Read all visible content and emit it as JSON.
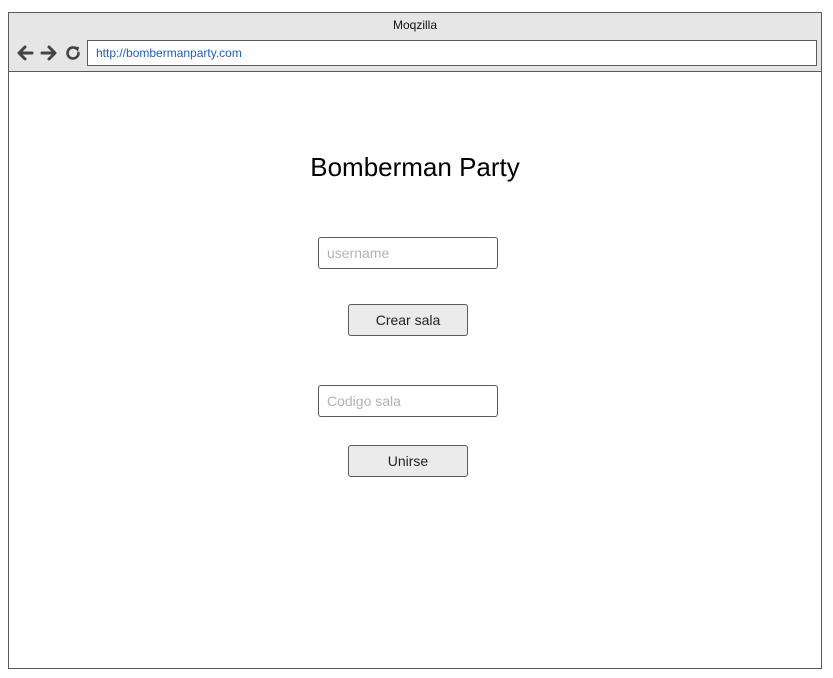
{
  "window": {
    "title": "Moqzilla"
  },
  "toolbar": {
    "back_icon": "arrow-left-icon",
    "forward_icon": "arrow-right-icon",
    "reload_icon": "reload-icon",
    "url": "http://bombermanparty.com"
  },
  "page": {
    "title": "Bomberman Party",
    "username": {
      "placeholder": "username",
      "value": ""
    },
    "create_room_label": "Crear sala",
    "room_code": {
      "placeholder": "Codigo sala",
      "value": ""
    },
    "join_label": "Unirse"
  },
  "colors": {
    "chrome_background": "#e6e6e6",
    "border": "#5a5a5a",
    "url_text": "#1f5fbf",
    "button_background": "#ebebeb",
    "placeholder_text": "#b3b3b3"
  }
}
